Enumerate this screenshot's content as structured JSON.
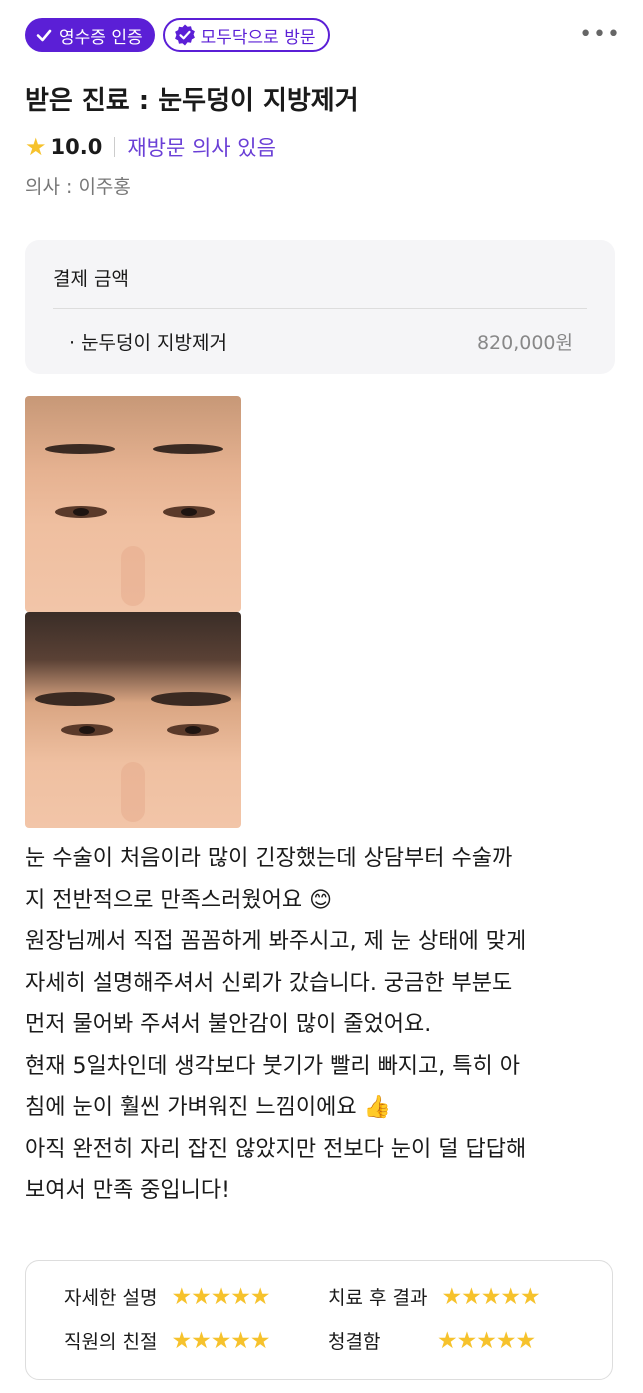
{
  "badges": {
    "receipt": "영수증 인증",
    "visit": "모두닥으로 방문"
  },
  "title": "받은 진료 : 눈두덩이 지방제거",
  "rating": {
    "score": "10.0",
    "revisit": "재방문 의사 있음"
  },
  "doctor": "의사 : 이주홍",
  "payment": {
    "label": "결제 금액",
    "item": "· 눈두덩이 지방제거",
    "price": "820,000원"
  },
  "review": [
    "눈 수술이 처음이라 많이 긴장했는데 상담부터 수술까",
    "지 전반적으로 만족스러웠어요 😊",
    "원장님께서 직접 꼼꼼하게 봐주시고, 제 눈 상태에 맞게",
    "자세히 설명해주셔서 신뢰가 갔습니다. 궁금한 부분도",
    "먼저 물어봐 주셔서 불안감이 많이 줄었어요.",
    "현재 5일차인데 생각보다 붓기가 빨리 빠지고, 특히 아",
    "침에 눈이 훨씬 가벼워진 느낌이에요 👍",
    "아직 완전히 자리 잡진 않았지만 전보다 눈이 덜 답답해",
    "보여서 만족 중입니다!"
  ],
  "scores": [
    {
      "label": "자세한 설명",
      "stars": "★★★★★",
      "rating": 5
    },
    {
      "label": "치료 후 결과",
      "stars": "★★★★★",
      "rating": 5
    },
    {
      "label": "직원의 친절",
      "stars": "★★★★★",
      "rating": 5
    },
    {
      "label": "청결함",
      "stars": "★★★★★",
      "rating": 5
    }
  ],
  "colors": {
    "accent": "#5b1fd6",
    "star": "#f6c22c",
    "revisit": "#6a3fd6"
  }
}
